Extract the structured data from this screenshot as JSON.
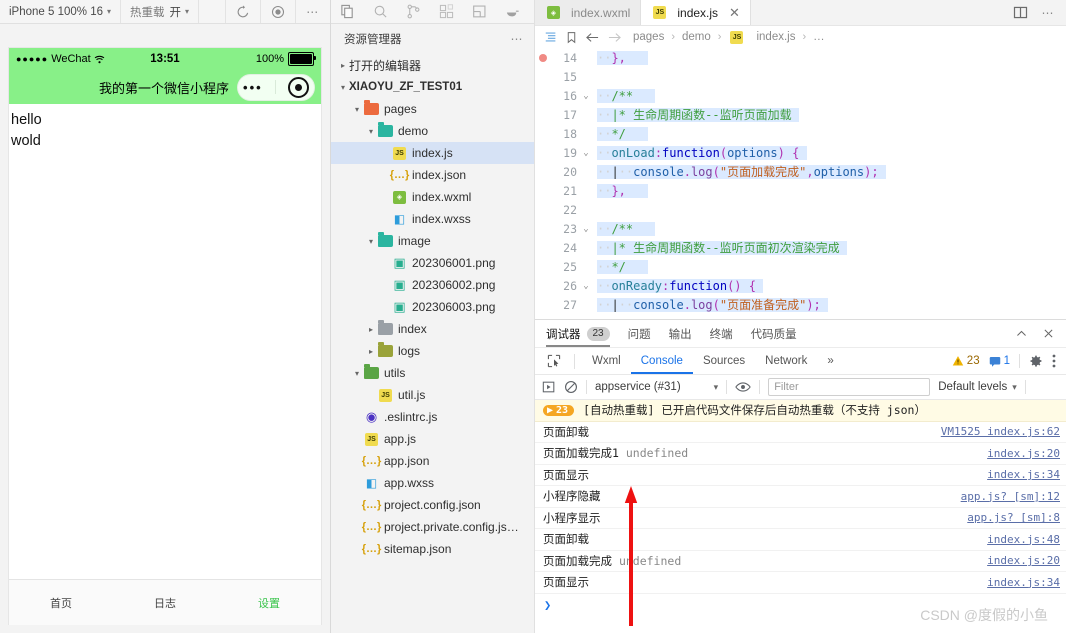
{
  "simulator": {
    "toolbar": {
      "device": "iPhone 5 100% 16",
      "hot_reload_label": "热重载",
      "hot_reload_value": "开",
      "refresh_icon": "refresh-icon",
      "record_icon": "record-icon",
      "more_icon": "more-icon"
    },
    "status_bar": {
      "carrier": "WeChat",
      "signal_dots": "●●●●●",
      "wifi_icon": "wifi-icon",
      "time": "13:51",
      "battery_percent": "100%"
    },
    "nav": {
      "title": "我的第一个微信小程序",
      "capsule_dots": "•••",
      "capsule_target_icon": "target-icon"
    },
    "page_lines": [
      "hello",
      "wold"
    ],
    "tabbar": [
      {
        "label": "首页",
        "active": false
      },
      {
        "label": "日志",
        "active": false
      },
      {
        "label": "设置",
        "active": true
      }
    ],
    "accent_green": "#88f088",
    "tab_active_color": "#39c44b"
  },
  "activity_bar": {
    "icons": [
      "files-icon",
      "search-icon",
      "source-control-icon",
      "extensions-icon",
      "layout-icon",
      "docker-icon"
    ]
  },
  "explorer": {
    "title": "资源管理器",
    "more_icon": "more-icon",
    "open_editors": "打开的编辑器",
    "project": "XIAOYU_ZF_TEST01",
    "tree": [
      {
        "label": "pages",
        "indent": 1,
        "twisty": "▾",
        "icon": "folder-open-red",
        "kind": "folder",
        "selected": false
      },
      {
        "label": "demo",
        "indent": 2,
        "twisty": "▾",
        "icon": "folder-open-teal",
        "kind": "folder",
        "selected": false
      },
      {
        "label": "index.js",
        "indent": 3,
        "twisty": "",
        "icon": "js-icon",
        "kind": "js",
        "selected": true
      },
      {
        "label": "index.json",
        "indent": 3,
        "twisty": "",
        "icon": "json-icon",
        "kind": "json",
        "selected": false
      },
      {
        "label": "index.wxml",
        "indent": 3,
        "twisty": "",
        "icon": "wxml-icon",
        "kind": "wxml",
        "selected": false
      },
      {
        "label": "index.wxss",
        "indent": 3,
        "twisty": "",
        "icon": "wxss-icon",
        "kind": "wxss",
        "selected": false
      },
      {
        "label": "image",
        "indent": 2,
        "twisty": "▾",
        "icon": "folder-open-teal",
        "kind": "folder",
        "selected": false
      },
      {
        "label": "202306001.png",
        "indent": 3,
        "twisty": "",
        "icon": "png-icon",
        "kind": "png",
        "selected": false
      },
      {
        "label": "202306002.png",
        "indent": 3,
        "twisty": "",
        "icon": "png-icon",
        "kind": "png",
        "selected": false
      },
      {
        "label": "202306003.png",
        "indent": 3,
        "twisty": "",
        "icon": "png-icon",
        "kind": "png",
        "selected": false
      },
      {
        "label": "index",
        "indent": 2,
        "twisty": "▸",
        "icon": "folder-gray",
        "kind": "folder",
        "selected": false
      },
      {
        "label": "logs",
        "indent": 2,
        "twisty": "▸",
        "icon": "folder-olive",
        "kind": "folder",
        "selected": false
      },
      {
        "label": "utils",
        "indent": 1,
        "twisty": "▾",
        "icon": "folder-open-green",
        "kind": "folder",
        "selected": false
      },
      {
        "label": "util.js",
        "indent": 2,
        "twisty": "",
        "icon": "js-icon",
        "kind": "js",
        "selected": false
      },
      {
        "label": ".eslintrc.js",
        "indent": 1,
        "twisty": "",
        "icon": "eslint-icon",
        "kind": "esl",
        "selected": false
      },
      {
        "label": "app.js",
        "indent": 1,
        "twisty": "",
        "icon": "js-icon",
        "kind": "js",
        "selected": false
      },
      {
        "label": "app.json",
        "indent": 1,
        "twisty": "",
        "icon": "json-icon",
        "kind": "json",
        "selected": false
      },
      {
        "label": "app.wxss",
        "indent": 1,
        "twisty": "",
        "icon": "wxss-icon",
        "kind": "wxss",
        "selected": false
      },
      {
        "label": "project.config.json",
        "indent": 1,
        "twisty": "",
        "icon": "json-icon",
        "kind": "json",
        "selected": false
      },
      {
        "label": "project.private.config.js…",
        "indent": 1,
        "twisty": "",
        "icon": "json-icon",
        "kind": "json",
        "selected": false
      },
      {
        "label": "sitemap.json",
        "indent": 1,
        "twisty": "",
        "icon": "json-icon",
        "kind": "json",
        "selected": false
      }
    ]
  },
  "editor": {
    "tabs": [
      {
        "label": "index.wxml",
        "kind": "wxml",
        "active": false,
        "closable": false
      },
      {
        "label": "index.js",
        "kind": "js",
        "active": true,
        "closable": true
      }
    ],
    "tab_close_glyph": "✕",
    "split_icon": "split-editor-icon",
    "more_icon": "more-icon",
    "breadcrumb": {
      "outline_icon": "outline-icon",
      "bookmark_icon": "bookmark-icon",
      "back_icon": "arrow-left-icon",
      "forward_icon": "arrow-right-icon",
      "items": [
        "pages",
        "demo",
        "index.js",
        "…"
      ],
      "separator": "›"
    },
    "lines": [
      {
        "n": "14",
        "fold": "",
        "breakpoint": true,
        "indent": 2,
        "code": "},",
        "type": "plain",
        "highlight": true
      },
      {
        "n": "15",
        "fold": "",
        "breakpoint": false,
        "indent": 0,
        "code": "",
        "type": "blank",
        "highlight": false
      },
      {
        "n": "16",
        "fold": "⌄",
        "breakpoint": false,
        "indent": 2,
        "code": "/**",
        "type": "comment",
        "highlight": true
      },
      {
        "n": "17",
        "fold": "",
        "breakpoint": false,
        "indent": 3,
        "code": "* 生命周期函数--监听页面加载",
        "type": "comment-cn",
        "highlight": true
      },
      {
        "n": "18",
        "fold": "",
        "breakpoint": false,
        "indent": 3,
        "code": "*/",
        "type": "comment",
        "highlight": true
      },
      {
        "n": "19",
        "fold": "⌄",
        "breakpoint": false,
        "indent": 2,
        "code": "onLoad:function(options) {",
        "type": "onload",
        "highlight": true
      },
      {
        "n": "20",
        "fold": "",
        "breakpoint": false,
        "indent": 4,
        "code": "console.log(\"页面加载完成\",options);",
        "type": "log1",
        "highlight": true
      },
      {
        "n": "21",
        "fold": "",
        "breakpoint": false,
        "indent": 2,
        "code": "},",
        "type": "plain",
        "highlight": true
      },
      {
        "n": "22",
        "fold": "",
        "breakpoint": false,
        "indent": 0,
        "code": "",
        "type": "blank",
        "highlight": false
      },
      {
        "n": "23",
        "fold": "⌄",
        "breakpoint": false,
        "indent": 2,
        "code": "/**",
        "type": "comment",
        "highlight": true
      },
      {
        "n": "24",
        "fold": "",
        "breakpoint": false,
        "indent": 3,
        "code": "* 生命周期函数--监听页面初次渲染完成",
        "type": "comment-cn",
        "highlight": true
      },
      {
        "n": "25",
        "fold": "",
        "breakpoint": false,
        "indent": 3,
        "code": "*/",
        "type": "comment",
        "highlight": true
      },
      {
        "n": "26",
        "fold": "⌄",
        "breakpoint": false,
        "indent": 2,
        "code": "onReady:function() {",
        "type": "onready",
        "highlight": true
      },
      {
        "n": "27",
        "fold": "",
        "breakpoint": false,
        "indent": 4,
        "code": "console.log(\"页面准备完成\");",
        "type": "log2",
        "highlight": true
      }
    ],
    "code_tokens": {
      "onload_name": "onLoad",
      "onready_name": "onReady",
      "colon": ":",
      "function_kw": "function",
      "paren_open": "(",
      "paren_close": ")",
      "options_param": "options",
      "brace_open": "{",
      "console": "console",
      "dot": ".",
      "log": "log",
      "str_load": "\"页面加载完成\"",
      "str_ready": "\"页面准备完成\"",
      "comma": ",",
      "semi": ");",
      "close_brace": "},"
    }
  },
  "devtools": {
    "panel_tabs": [
      {
        "label": "调试器",
        "badge": "23",
        "active": true
      },
      {
        "label": "问题",
        "badge": "",
        "active": false
      },
      {
        "label": "输出",
        "badge": "",
        "active": false
      },
      {
        "label": "终端",
        "badge": "",
        "active": false
      },
      {
        "label": "代码质量",
        "badge": "",
        "active": false
      }
    ],
    "panel_actions": {
      "collapse_icon": "chevron-up-icon",
      "close_icon": "close-icon"
    },
    "inspector_icon": "inspect-element-icon",
    "tabs": [
      {
        "label": "Wxml",
        "active": false
      },
      {
        "label": "Console",
        "active": true
      },
      {
        "label": "Sources",
        "active": false
      },
      {
        "label": "Network",
        "active": false
      },
      {
        "label": "»",
        "active": false
      }
    ],
    "counters": {
      "warning_icon": "warning-icon",
      "warnings": "23",
      "message_icon": "message-icon",
      "messages": "1"
    },
    "tab_actions": {
      "settings_icon": "gear-icon",
      "more_icon": "kebab-menu-icon"
    },
    "filter_bar": {
      "play_icon": "step-into-icon",
      "clear_icon": "clear-console-icon",
      "context": "appservice (#31)",
      "context_caret": "▾",
      "eye_icon": "eye-icon",
      "filter_placeholder": "Filter",
      "filter_value": "",
      "levels": "Default levels",
      "levels_caret": "▾"
    },
    "notice": {
      "count": "23",
      "play_glyph": "▶",
      "text": "[自动热重载] 已开启代码文件保存后自动热重载（不支持 json）"
    },
    "logs": [
      {
        "msg": "页面卸载",
        "extra": "",
        "source": "VM1525 index.js:62"
      },
      {
        "msg": "页面加载完成1",
        "extra": "undefined",
        "source": "index.js:20"
      },
      {
        "msg": "页面显示",
        "extra": "",
        "source": "index.js:34"
      },
      {
        "msg": "小程序隐藏",
        "extra": "",
        "source": "app.js? [sm]:12"
      },
      {
        "msg": "小程序显示",
        "extra": "",
        "source": "app.js? [sm]:8"
      },
      {
        "msg": "页面卸载",
        "extra": "",
        "source": "index.js:48"
      },
      {
        "msg": "页面加载完成",
        "extra": "undefined",
        "source": "index.js:20"
      },
      {
        "msg": "页面显示",
        "extra": "",
        "source": "index.js:34"
      }
    ],
    "prompt_glyph": "❯"
  },
  "annotation": {
    "arrow_color": "#ee1111",
    "arrow_name": "red-pointer-arrow"
  },
  "watermark": "CSDN @度假的小鱼"
}
